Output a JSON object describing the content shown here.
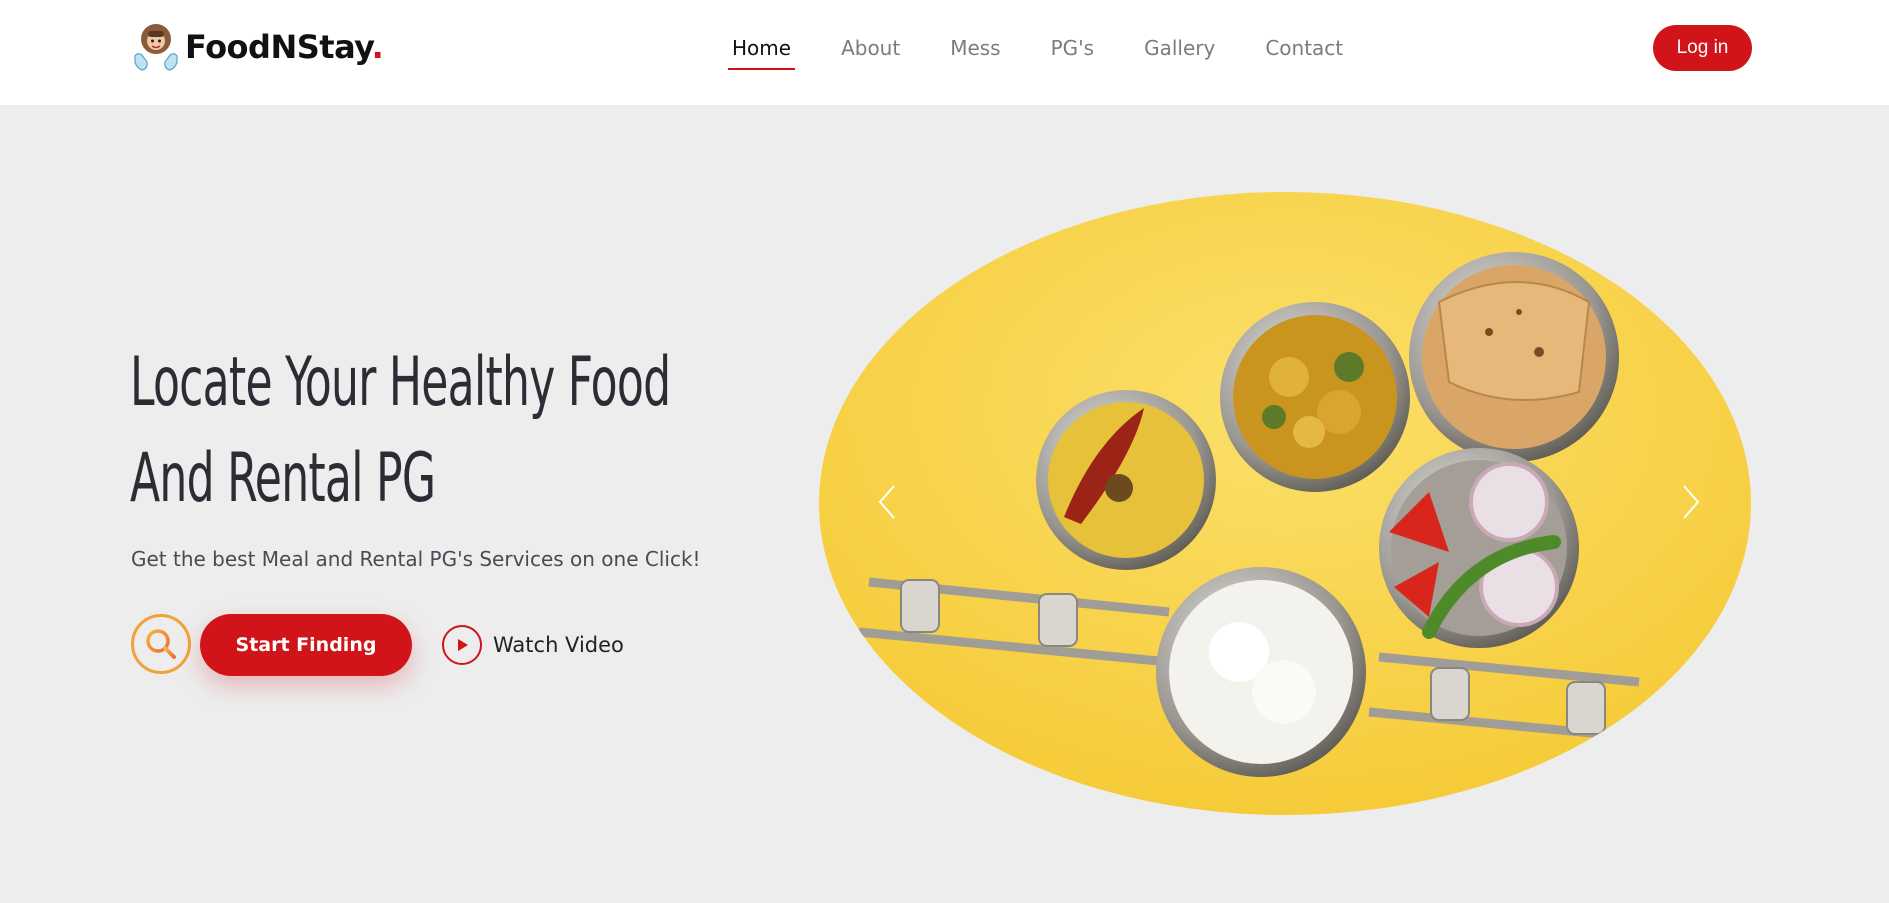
{
  "brand": {
    "name": "FoodNStay",
    "dot": ".",
    "logo_icon": "mascot-hands-icon",
    "accent_color": "#d0141a"
  },
  "nav": {
    "items": [
      {
        "label": "Home",
        "active": true
      },
      {
        "label": "About",
        "active": false
      },
      {
        "label": "Mess",
        "active": false
      },
      {
        "label": "PG's",
        "active": false
      },
      {
        "label": "Gallery",
        "active": false
      },
      {
        "label": "Contact",
        "active": false
      }
    ],
    "login_label": "Log in"
  },
  "hero": {
    "title_line1": "Locate Your Healthy Food",
    "title_line2": "And Rental PG",
    "subtitle": "Get the best Meal and Rental PG's Services on one Click!",
    "start_label": "Start Finding",
    "watch_label": "Watch Video",
    "background_color": "#ededed"
  },
  "carousel": {
    "image": "tiffin-meal-photo",
    "prev_icon": "chevron-left-icon",
    "next_icon": "chevron-right-icon",
    "background_color": "#f7cf3c"
  }
}
